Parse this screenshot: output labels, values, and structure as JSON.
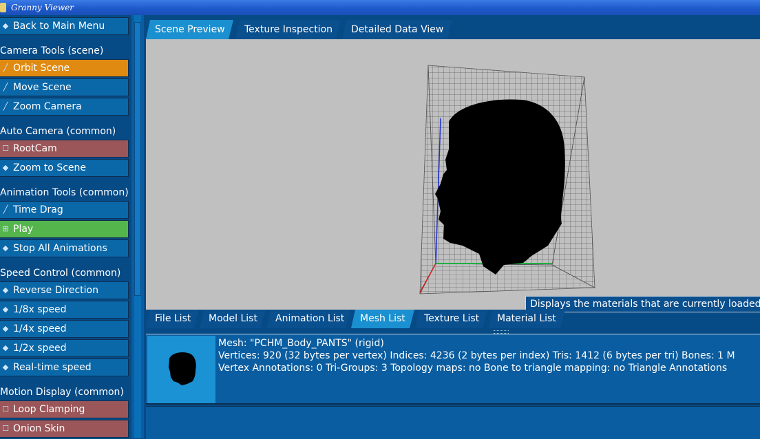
{
  "window": {
    "title": "Granny Viewer"
  },
  "sidebar": {
    "items": [
      {
        "kind": "button",
        "label": "Back to Main Menu",
        "icon": "diamond-icon",
        "glyph": "◆",
        "style": "blue"
      },
      {
        "kind": "header",
        "label": "Camera Tools (scene)"
      },
      {
        "kind": "button",
        "label": "Orbit Scene",
        "icon": "slash-tool-icon",
        "glyph": "╱",
        "style": "orange"
      },
      {
        "kind": "button",
        "label": "Move Scene",
        "icon": "slash-tool-icon",
        "glyph": "╱",
        "style": "blue"
      },
      {
        "kind": "button",
        "label": "Zoom Camera",
        "icon": "slash-tool-icon",
        "glyph": "╱",
        "style": "blue"
      },
      {
        "kind": "header",
        "label": "Auto Camera (common)"
      },
      {
        "kind": "button",
        "label": "RootCam",
        "icon": "checkbox-icon",
        "glyph": "☐",
        "style": "red"
      },
      {
        "kind": "button",
        "label": "Zoom to Scene",
        "icon": "diamond-icon",
        "glyph": "◆",
        "style": "blue"
      },
      {
        "kind": "header",
        "label": "Animation Tools (common)"
      },
      {
        "kind": "button",
        "label": "Time Drag",
        "icon": "slash-tool-icon",
        "glyph": "╱",
        "style": "blue"
      },
      {
        "kind": "button",
        "label": "Play",
        "icon": "grid-checkbox-icon",
        "glyph": "⊞",
        "style": "green"
      },
      {
        "kind": "button",
        "label": "Stop All Animations",
        "icon": "diamond-icon",
        "glyph": "◆",
        "style": "blue"
      },
      {
        "kind": "header",
        "label": "Speed Control (common)"
      },
      {
        "kind": "button",
        "label": "Reverse Direction",
        "icon": "diamond-icon",
        "glyph": "◆",
        "style": "blue"
      },
      {
        "kind": "button",
        "label": "1/8x speed",
        "icon": "diamond-icon",
        "glyph": "◆",
        "style": "blue"
      },
      {
        "kind": "button",
        "label": "1/4x speed",
        "icon": "diamond-icon",
        "glyph": "◆",
        "style": "blue"
      },
      {
        "kind": "button",
        "label": "1/2x speed",
        "icon": "diamond-icon",
        "glyph": "◆",
        "style": "blue"
      },
      {
        "kind": "button",
        "label": "Real-time speed",
        "icon": "diamond-icon",
        "glyph": "◆",
        "style": "blue"
      },
      {
        "kind": "header",
        "label": "Motion Display (common)"
      },
      {
        "kind": "button",
        "label": "Loop Clamping",
        "icon": "checkbox-icon",
        "glyph": "☐",
        "style": "red"
      },
      {
        "kind": "button",
        "label": "Onion Skin",
        "icon": "checkbox-icon",
        "glyph": "☐",
        "style": "red"
      }
    ]
  },
  "top_tabs": [
    {
      "label": "Scene Preview",
      "active": true
    },
    {
      "label": "Texture Inspection",
      "active": false
    },
    {
      "label": "Detailed Data View",
      "active": false
    }
  ],
  "bottom_tabs": [
    {
      "label": "File List",
      "active": false
    },
    {
      "label": "Model List",
      "active": false
    },
    {
      "label": "Animation List",
      "active": false
    },
    {
      "label": "Mesh List",
      "active": true
    },
    {
      "label": "Texture List",
      "active": false
    },
    {
      "label": "Material List",
      "active": false
    }
  ],
  "tooltip": {
    "text": "Displays the materials that are currently loaded"
  },
  "mesh_info": {
    "line1": "Mesh: \"PCHM_Body_PANTS\" (rigid)",
    "line2": "Vertices: 920 (32 bytes per vertex)    Indices: 4236 (2 bytes per index)    Tris: 1412 (6 bytes per tri)    Bones: 1    M",
    "line3": "Vertex Annotations: 0    Tri-Groups: 3    Topology maps: no    Bone to triangle mapping: no    Triangle Annotations"
  },
  "colors": {
    "panel_blue": "#0a67a8",
    "active_orange": "#e08a12",
    "toggle_red": "#9a5659",
    "active_green": "#55b54d",
    "active_tab": "#1b90d0"
  }
}
